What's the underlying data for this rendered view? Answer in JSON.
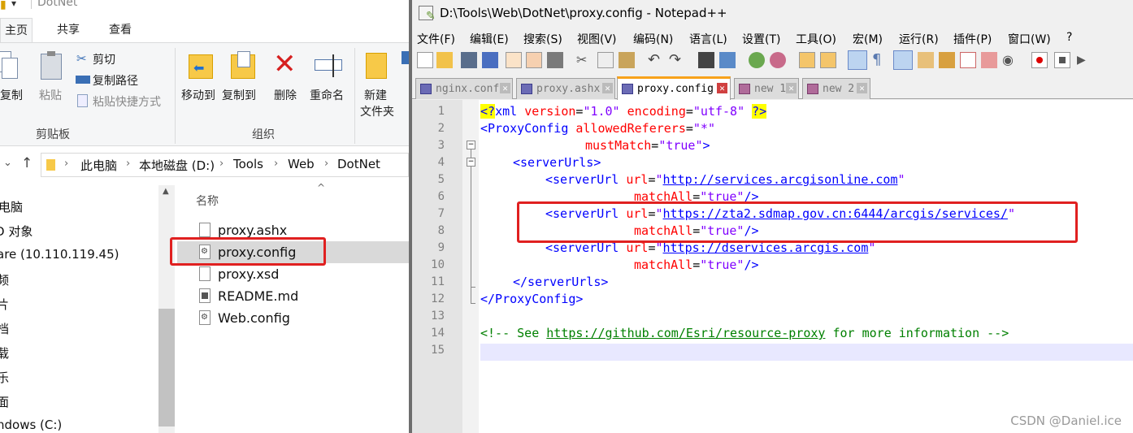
{
  "explorer": {
    "title": "DotNet",
    "tabs": [
      "主页",
      "共享",
      "查看"
    ],
    "ribbon": {
      "copy": "复制",
      "paste": "粘贴",
      "cut": "剪切",
      "copy_path": "复制路径",
      "paste_shortcut": "粘贴快捷方式",
      "clipboard_group": "剪贴板",
      "move_to": "移动到",
      "copy_to": "复制到",
      "delete": "删除",
      "rename": "重命名",
      "organize_group": "组织",
      "new_folder_1": "新建",
      "new_folder_2": "文件夹"
    },
    "breadcrumb": [
      "此电脑",
      "本地磁盘 (D:)",
      "Tools",
      "Web",
      "DotNet"
    ],
    "nav_items": [
      "电脑",
      "D 对象",
      "are (10.110.119.45)",
      "频",
      "片",
      "档",
      "载",
      "乐",
      "面",
      "ndows (C:)"
    ],
    "column_name": "名称",
    "files": [
      "proxy.ashx",
      "proxy.config",
      "proxy.xsd",
      "README.md",
      "Web.config"
    ]
  },
  "npp": {
    "title": "D:\\Tools\\Web\\DotNet\\proxy.config - Notepad++",
    "menu": [
      "文件(F)",
      "编辑(E)",
      "搜索(S)",
      "视图(V)",
      "编码(N)",
      "语言(L)",
      "设置(T)",
      "工具(O)",
      "宏(M)",
      "运行(R)",
      "插件(P)",
      "窗口(W)",
      "?"
    ],
    "tabs": [
      "nginx.conf",
      "proxy.ashx",
      "proxy.config",
      "new 1",
      "new 2"
    ],
    "active_tab": 2,
    "line_numbers": [
      "1",
      "2",
      "3",
      "4",
      "5",
      "6",
      "7",
      "8",
      "9",
      "10",
      "11",
      "12",
      "13",
      "14",
      "15"
    ],
    "code": {
      "l1_a": "<?",
      "l1_b": "xml ",
      "l1_c": "version",
      "l1_d": "=",
      "l1_e": "\"1.0\"",
      "l1_f": " encoding",
      "l1_g": "=",
      "l1_h": "\"utf-8\"",
      "l1_i": " ",
      "l1_j": "?>",
      "l2_a": "<ProxyConfig ",
      "l2_b": "allowedReferers",
      "l2_c": "=",
      "l2_d": "\"*\"",
      "l3_a": "mustMatch",
      "l3_b": "=",
      "l3_c": "\"true\"",
      "l3_d": ">",
      "l4_a": "<serverUrls>",
      "l5_a": "<serverUrl ",
      "l5_b": "url",
      "l5_c": "=",
      "l5_d": "\"",
      "l5_e": "http://services.arcgisonline.com",
      "l5_f": "\"",
      "l6_a": "matchAll",
      "l6_b": "=",
      "l6_c": "\"true\"",
      "l6_d": "/>",
      "l7_a": "<serverUrl ",
      "l7_b": "url",
      "l7_c": "=",
      "l7_d": "\"",
      "l7_e": "https://zta2.sdmap.gov.cn:6444/arcgis/services/",
      "l7_f": "\"",
      "l8_a": "matchAll",
      "l8_b": "=",
      "l8_c": "\"true\"",
      "l8_d": "/>",
      "l9_a": "<serverUrl ",
      "l9_b": "url",
      "l9_c": "=",
      "l9_d": "\"",
      "l9_e": "https://dservices.arcgis.com",
      "l9_f": "\"",
      "l10_a": "matchAll",
      "l10_b": "=",
      "l10_c": "\"true\"",
      "l10_d": "/>",
      "l11_a": "</serverUrls>",
      "l12_a": "</ProxyConfig>",
      "l14_a": "<!-- See ",
      "l14_b": "https://github.com/Esri/resource-proxy",
      "l14_c": " for more information -->"
    }
  },
  "watermark": "CSDN @Daniel.ice",
  "colors": {
    "tag": "#0000ff",
    "attr": "#ff0000",
    "value": "#8000ff",
    "comment": "#008000",
    "highlight_box": "#e02020"
  }
}
